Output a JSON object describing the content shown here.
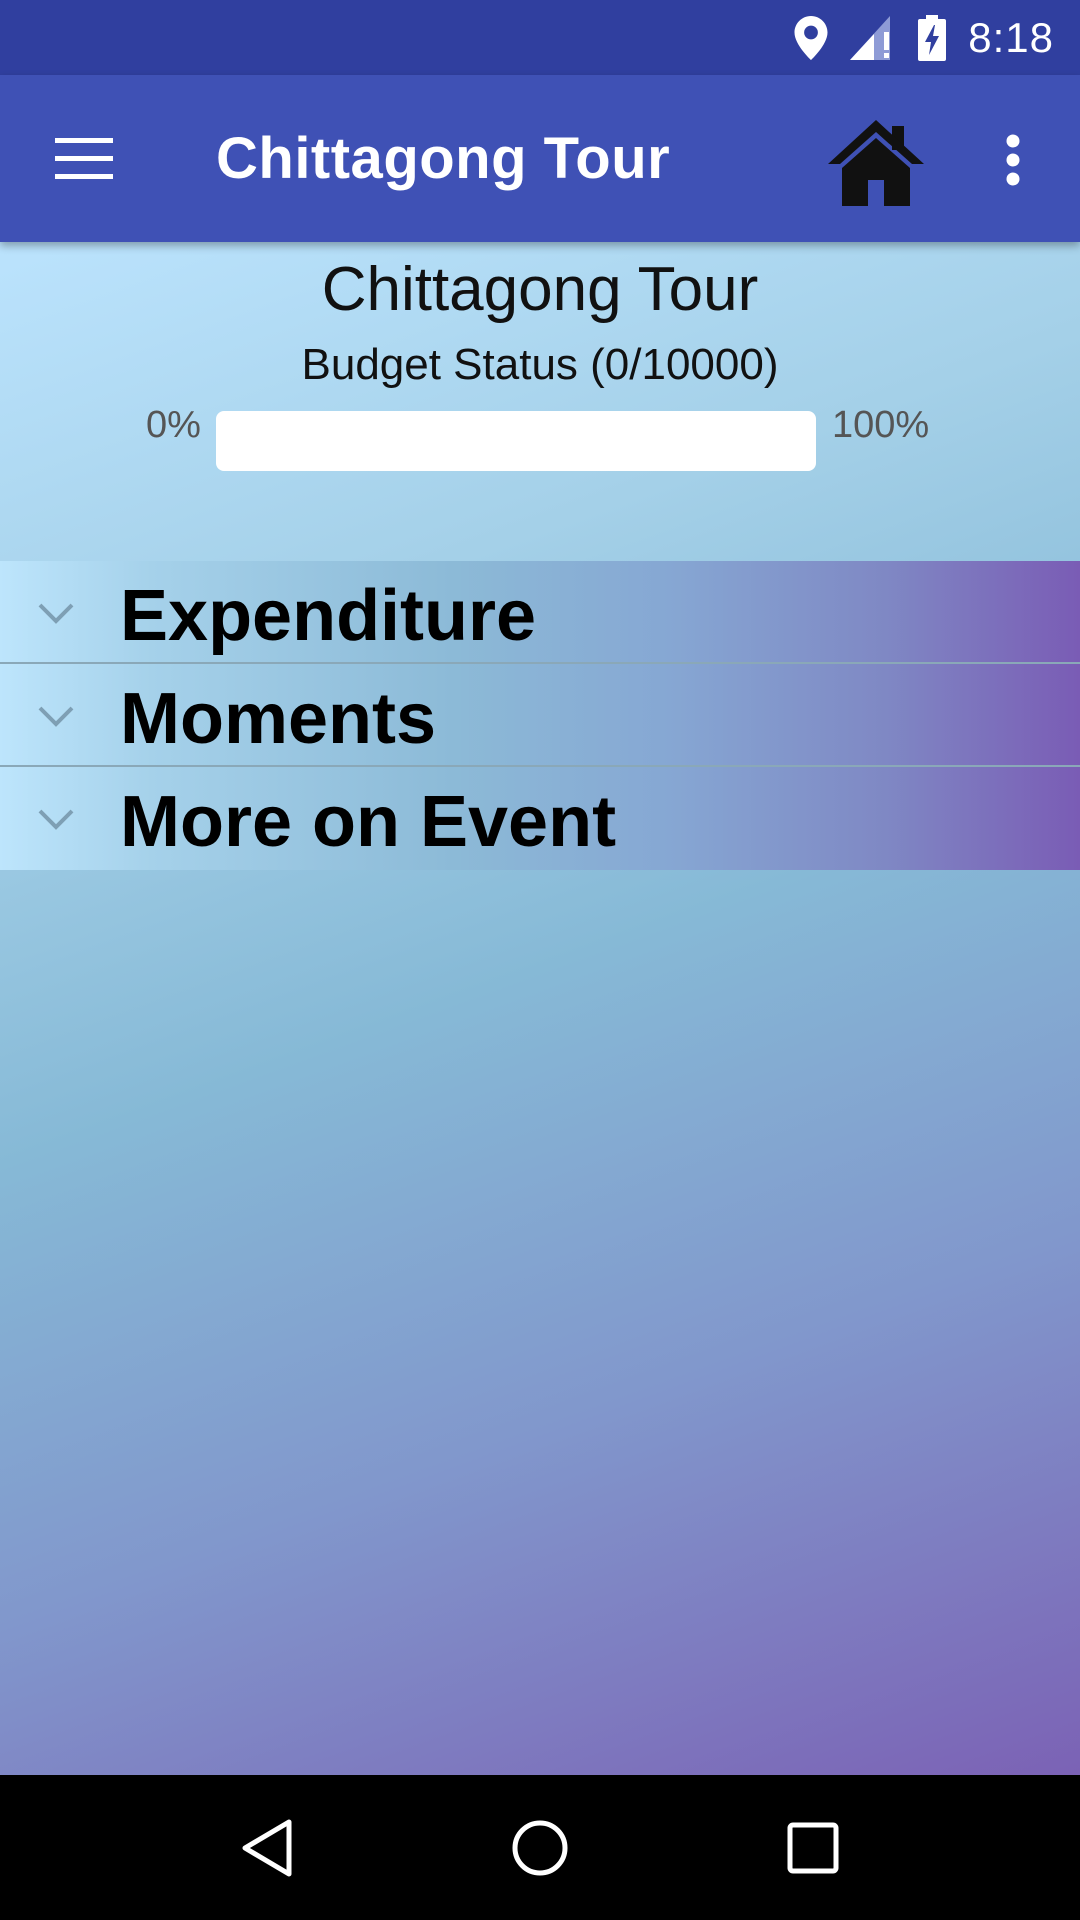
{
  "status_bar": {
    "time": "8:18",
    "icons": [
      "location-icon",
      "cell-signal-icon",
      "battery-charging-icon"
    ]
  },
  "app_bar": {
    "title": "Chittagong Tour",
    "menu_icon": "hamburger-menu-icon",
    "home_icon": "home-icon",
    "overflow_icon": "more-vert-icon"
  },
  "budget": {
    "event_title": "Chittagong Tour",
    "status_label": "Budget Status (0/10000)",
    "spent": 0,
    "total": 10000,
    "progress_fraction": 0,
    "min_label": "0%",
    "max_label": "100%"
  },
  "sections": [
    {
      "label": "Expenditure",
      "icon": "chevron-down-icon"
    },
    {
      "label": "Moments",
      "icon": "chevron-down-icon"
    },
    {
      "label": "More on Event",
      "icon": "chevron-down-icon"
    }
  ],
  "nav_bar": {
    "icons": [
      "back-icon",
      "home-circle-icon",
      "recents-icon"
    ]
  },
  "colors": {
    "status_bar": "#303F9F",
    "app_bar": "#3F51B5",
    "gradient_start": "#BBE3FD",
    "gradient_end": "#7B62B5"
  }
}
